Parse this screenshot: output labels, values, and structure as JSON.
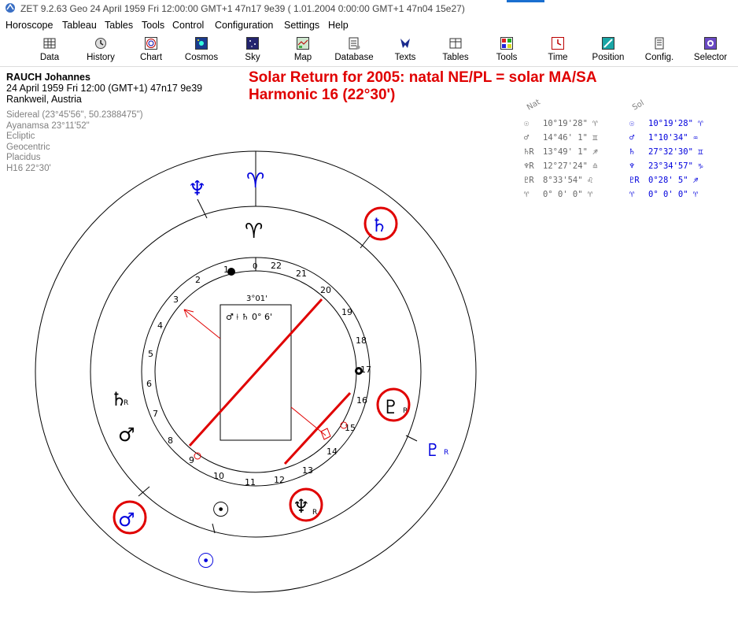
{
  "window": {
    "title": "ZET 9.2.63 Geo   24 April 1959  Fri  12:00:00 GMT+1 47n17  9e39   ( 1.01.2004   0:00:00 GMT+1 47n04 15e27)"
  },
  "menu": [
    "Horoscope",
    "Tableau",
    "Tables",
    "Tools",
    "Control",
    "Configuration",
    "Settings",
    "Help"
  ],
  "toolbar": [
    "Data",
    "History",
    "Chart",
    "Cosmos",
    "Sky",
    "Map",
    "Database",
    "Texts",
    "Tables",
    "Tools",
    "Time",
    "Position",
    "Config.",
    "Selector"
  ],
  "person": {
    "name": "RAUCH Johannes",
    "datetime": "24 April 1959  Fri  12:00 (GMT+1) 47n17  9e39",
    "place": "Rankweil, Austria"
  },
  "settings": [
    "Sidereal (23°45'56\", 50.2388475\")",
    "Ayanamsa 23°11'52\"",
    "Ecliptic",
    "Geocentric",
    "Placidus",
    "H16  22°30'"
  ],
  "annotation": {
    "line1": "Solar Return for 2005: natal NE/PL = solar MA/SA",
    "line2": "Harmonic 16 (22°30')"
  },
  "positions": {
    "natal_header": "Nat",
    "solar_header": "Sol",
    "natal": [
      {
        "glyph": "☉",
        "value": "10°19'28\" ♈"
      },
      {
        "glyph": "♂",
        "value": "14°46' 1\" ♊"
      },
      {
        "glyph": "♄R",
        "value": "13°49' 1\" ♐"
      },
      {
        "glyph": "♆R",
        "value": "12°27'24\" ♎"
      },
      {
        "glyph": "♇R",
        "value": "8°33'54\" ♌"
      },
      {
        "glyph": "♈",
        "value": "0° 0' 0\" ♈"
      }
    ],
    "solar": [
      {
        "glyph": "☉",
        "value": "10°19'28\" ♈"
      },
      {
        "glyph": "♂",
        "value": "1°10'34\" ♒"
      },
      {
        "glyph": "♄",
        "value": "27°32'30\" ♊"
      },
      {
        "glyph": "♆",
        "value": "23°34'57\" ♑"
      },
      {
        "glyph": "♇R",
        "value": "0°28' 5\" ♐"
      },
      {
        "glyph": "♈",
        "value": "0° 0' 0\" ♈"
      }
    ]
  },
  "chart": {
    "center_box_title": "3°01'",
    "center_box_text": "♂ ⟊ ♄    0° 6'",
    "tick_numbers": [
      "22",
      "21",
      "1",
      "2",
      "3",
      "4",
      "5",
      "6",
      "7",
      "8",
      "9",
      "10",
      "11",
      "12",
      "13",
      "14",
      "15",
      "16",
      "17",
      "18",
      "19",
      "20"
    ],
    "natal_glyphs": {
      "sun": "☉",
      "mars": "♂",
      "saturn": "♄",
      "neptune": "♆",
      "pluto": "♇",
      "aries": "♈"
    },
    "solar_glyphs": {
      "sun": "☉",
      "mars": "♂",
      "saturn": "♄",
      "neptune": "♆",
      "pluto": "♇",
      "aries": "♈"
    },
    "retro_mark": "R",
    "colors": {
      "natal": "#000000",
      "solar": "#0000dd",
      "highlight": "#e00000"
    }
  }
}
